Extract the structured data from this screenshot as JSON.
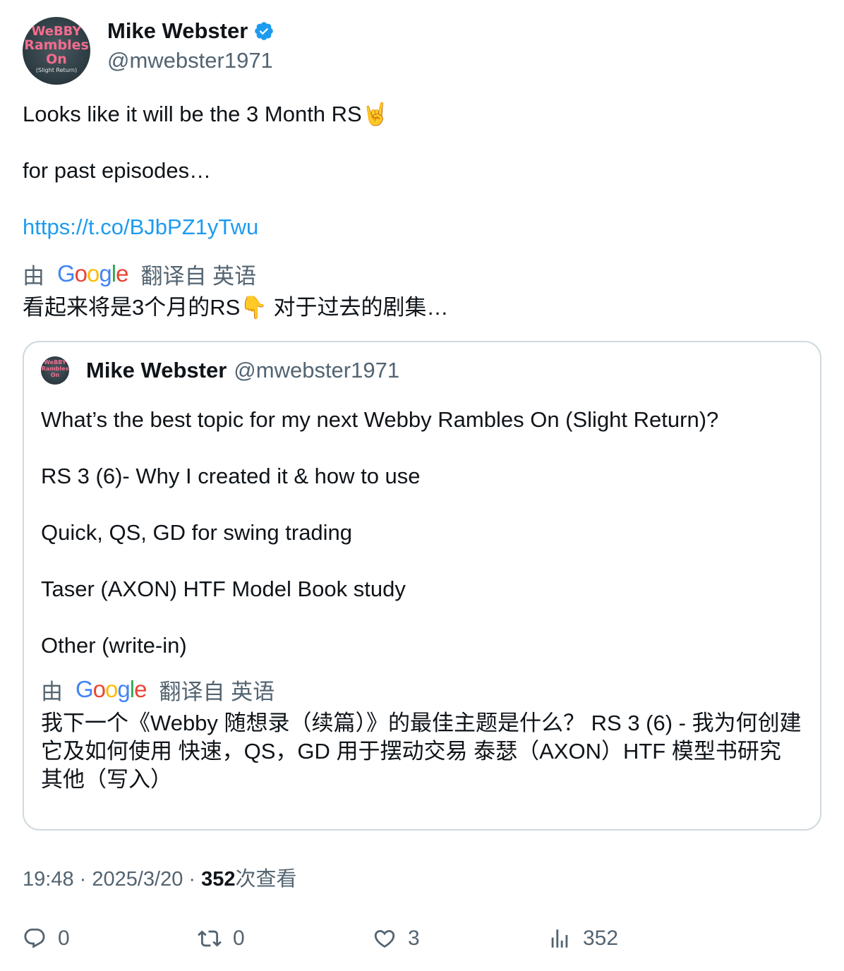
{
  "author": {
    "display_name": "Mike Webster",
    "handle": "@mwebster1971",
    "avatar_text": [
      "WeBBY",
      "Rambles",
      "On",
      "(Slight Return)"
    ]
  },
  "tweet": {
    "line1": "Looks like it will be the 3 Month RS🤘",
    "line2": "for past episodes…",
    "link": "https://t.co/BJbPZ1yTwu",
    "translate_prefix": "由",
    "translate_suffix": "翻译自 英语",
    "translated_text": "看起来将是3个月的RS👇 对于过去的剧集…"
  },
  "quote": {
    "display_name": "Mike Webster",
    "handle": "@mwebster1971",
    "lines": [
      "What’s the best topic for my next Webby Rambles On (Slight Return)?",
      "RS 3 (6)- Why I created it & how to use",
      "Quick, QS, GD for swing trading",
      "Taser (AXON) HTF Model Book study",
      "Other (write-in)"
    ],
    "translate_prefix": "由",
    "translate_suffix": "翻译自 英语",
    "translated_text": "我下一个《Webby 随想录（续篇）》的最佳主题是什么？ RS 3 (6) - 我为何创建它及如何使用 快速，QS，GD 用于摆动交易 泰瑟（AXON）HTF 模型书研究 其他（写入）"
  },
  "meta": {
    "time": "19:48",
    "separator": " · ",
    "date": "2025/3/20",
    "views_count": "352",
    "views_label": "次查看"
  },
  "actions": {
    "replies": "0",
    "reposts": "0",
    "likes": "3",
    "views": "352"
  },
  "google_logo": [
    "G",
    "o",
    "o",
    "g",
    "l",
    "e"
  ],
  "colors": {
    "link": "#1d9bf0",
    "secondary_text": "#536471",
    "primary_text": "#0f1419",
    "verified": "#1d9bf0",
    "border": "#cfd9de"
  }
}
